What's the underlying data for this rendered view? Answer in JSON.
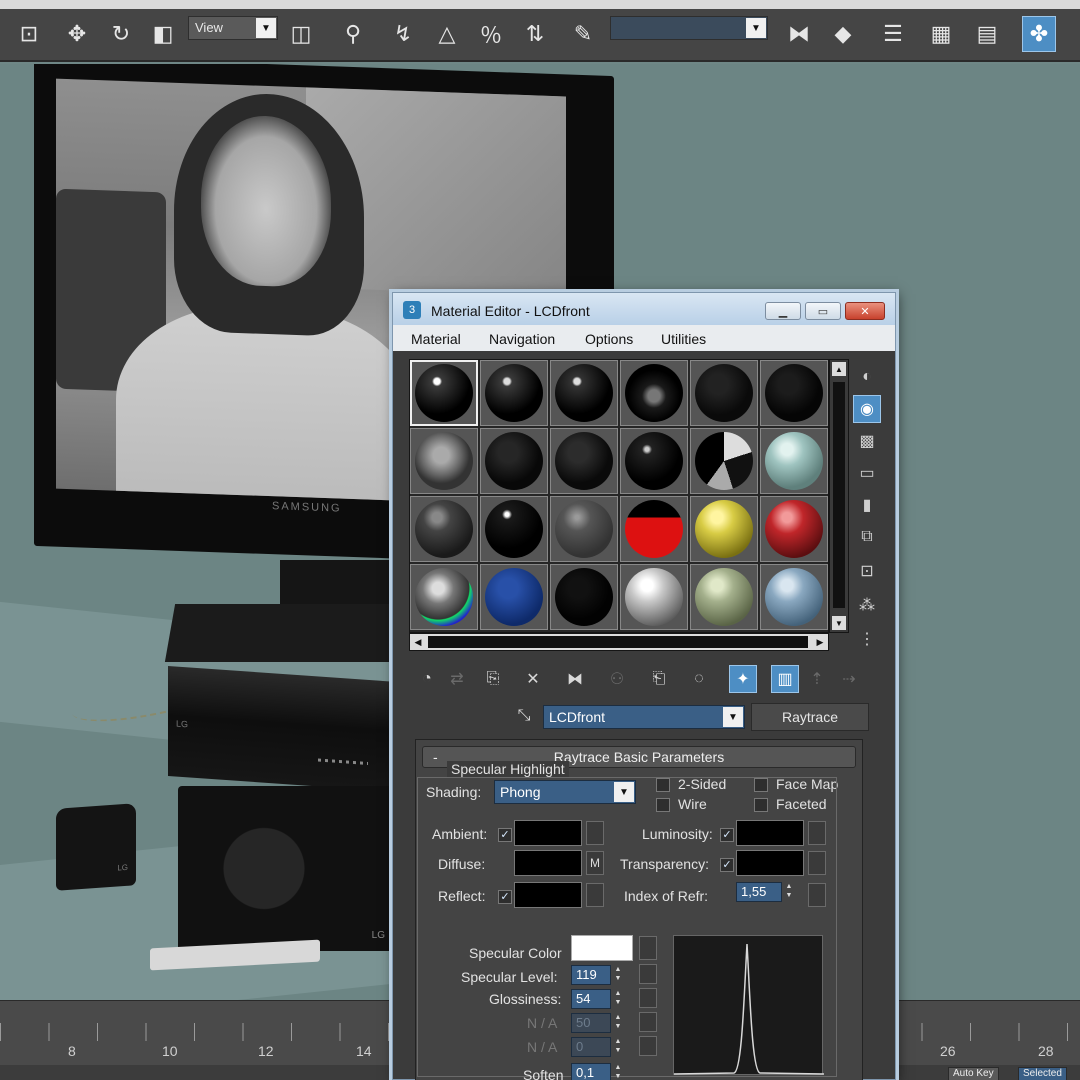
{
  "toolbar": {
    "view_dropdown": "View",
    "named_selection_value": ""
  },
  "viewport": {
    "monitor_brand": "SAMSUNG",
    "device_logo": "LG",
    "speaker_logo": "LG",
    "sub_logo": "LG"
  },
  "timeline": {
    "ticks": [
      "8",
      "10",
      "12",
      "14",
      "26",
      "28"
    ],
    "btn_left": "Auto Key",
    "btn_right": "Selected"
  },
  "material_editor": {
    "title": "Material Editor - LCDfront",
    "menu": [
      "Material",
      "Navigation",
      "Options",
      "Utilities"
    ],
    "material_name": "LCDfront",
    "material_type": "Raytrace",
    "rollout_title": "Raytrace Basic Parameters",
    "shading_label": "Shading:",
    "shading_value": "Phong",
    "two_sided": "2-Sided",
    "face_map": "Face Map",
    "wire": "Wire",
    "faceted": "Faceted",
    "ambient": "Ambient:",
    "diffuse": "Diffuse:",
    "diffuse_map": "M",
    "reflect": "Reflect:",
    "luminosity": "Luminosity:",
    "transparency": "Transparency:",
    "ior_label": "Index of Refr:",
    "ior_value": "1,55",
    "specular_group": "Specular Highlight",
    "specular_color": "Specular Color",
    "specular_level": "Specular Level:",
    "specular_level_value": "119",
    "glossiness": "Glossiness:",
    "glossiness_value": "54",
    "na1": "N / A",
    "na1_value": "50",
    "na2": "N / A",
    "na2_value": "0",
    "soften": "Soften",
    "soften_value": "0,1",
    "checkmark": "✓"
  },
  "colors": {
    "accent": "#4d8ec4",
    "field_blue": "#3a5f86",
    "panel": "#3b3b3b"
  }
}
